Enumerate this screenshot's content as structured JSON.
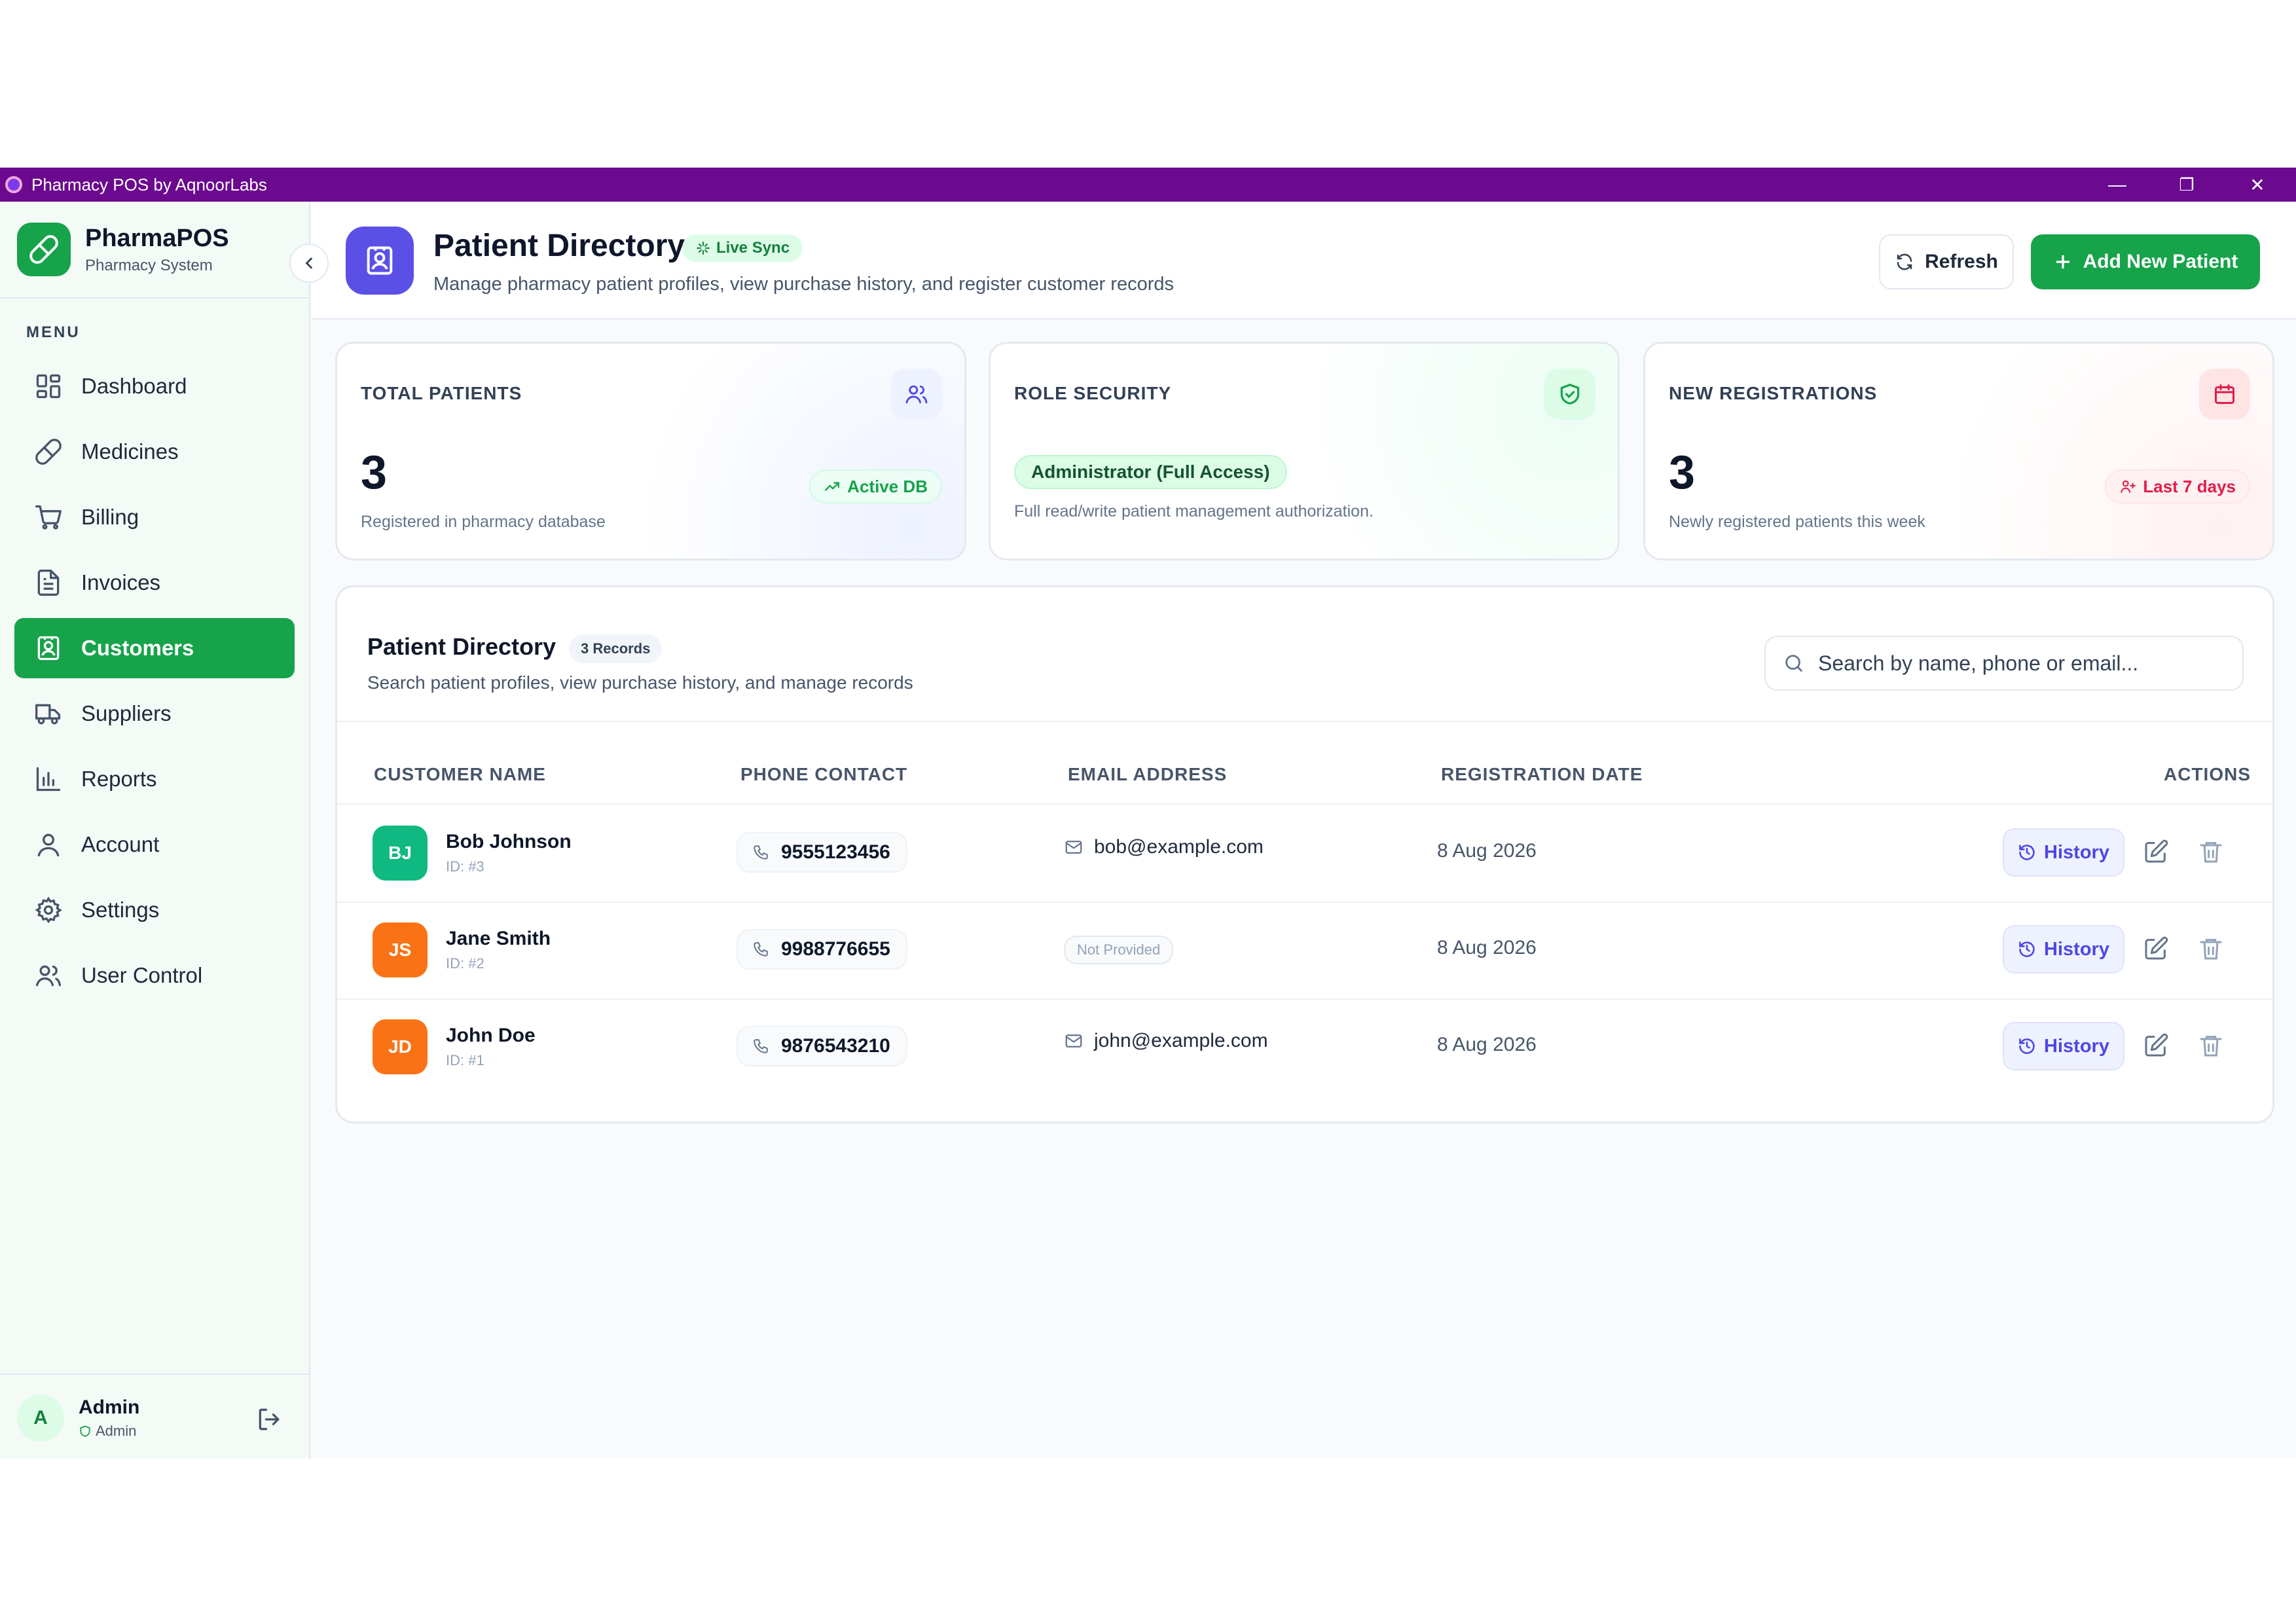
{
  "window": {
    "title": "Pharmacy POS by AqnoorLabs",
    "controls": {
      "minimize": "—",
      "restore": "❐",
      "close": "✕"
    }
  },
  "sidebar": {
    "brand_name": "PharmaPOS",
    "brand_sub": "Pharmacy System",
    "menu_label": "MENU",
    "items": [
      {
        "label": "Dashboard",
        "icon": "dashboard-icon",
        "active": false
      },
      {
        "label": "Medicines",
        "icon": "pill-icon",
        "active": false
      },
      {
        "label": "Billing",
        "icon": "cart-icon",
        "active": false
      },
      {
        "label": "Invoices",
        "icon": "document-icon",
        "active": false
      },
      {
        "label": "Customers",
        "icon": "contact-icon",
        "active": true
      },
      {
        "label": "Suppliers",
        "icon": "truck-icon",
        "active": false
      },
      {
        "label": "Reports",
        "icon": "bar-chart-icon",
        "active": false
      },
      {
        "label": "Account",
        "icon": "user-icon",
        "active": false
      },
      {
        "label": "Settings",
        "icon": "gear-icon",
        "active": false
      },
      {
        "label": "User Control",
        "icon": "users-icon",
        "active": false
      }
    ],
    "user": {
      "initial": "A",
      "name": "Admin",
      "role": "Admin"
    }
  },
  "header": {
    "title": "Patient Directory",
    "live_badge": "Live Sync",
    "subtitle": "Manage pharmacy patient profiles, view purchase history, and register customer records",
    "refresh_label": "Refresh",
    "add_label": "Add New Patient"
  },
  "cards": {
    "total": {
      "label": "TOTAL PATIENTS",
      "value": "3",
      "desc": "Registered in pharmacy database",
      "chip": "Active DB"
    },
    "role": {
      "label": "ROLE SECURITY",
      "chip": "Administrator (Full Access)",
      "desc": "Full read/write patient management authorization."
    },
    "newreg": {
      "label": "NEW REGISTRATIONS",
      "value": "3",
      "desc": "Newly registered patients this week",
      "chip": "Last 7 days"
    }
  },
  "directory": {
    "title": "Patient Directory",
    "records_badge": "3 Records",
    "subtitle": "Search patient profiles, view purchase history, and manage records",
    "search_placeholder": "Search by name, phone or email...",
    "columns": {
      "name": "CUSTOMER NAME",
      "phone": "PHONE CONTACT",
      "email": "EMAIL ADDRESS",
      "date": "REGISTRATION DATE",
      "actions": "ACTIONS"
    },
    "history_label": "History",
    "rows": [
      {
        "initials": "BJ",
        "name": "Bob Johnson",
        "id": "ID: #3",
        "phone": "9555123456",
        "email": "bob@example.com",
        "date": "8 Aug 2026",
        "avatar_color": "#10b981"
      },
      {
        "initials": "JS",
        "name": "Jane Smith",
        "id": "ID: #2",
        "phone": "9988776655",
        "email": "Not Provided",
        "date": "8 Aug 2026",
        "avatar_color": "#f97316"
      },
      {
        "initials": "JD",
        "name": "John Doe",
        "id": "ID: #1",
        "phone": "9876543210",
        "email": "john@example.com",
        "date": "8 Aug 2026",
        "avatar_color": "#f97316"
      }
    ]
  },
  "colors": {
    "titlebar": "#6b0a8e",
    "accent_green": "#16a34a",
    "accent_indigo": "#5b50e6",
    "danger_red": "#e11d48"
  }
}
